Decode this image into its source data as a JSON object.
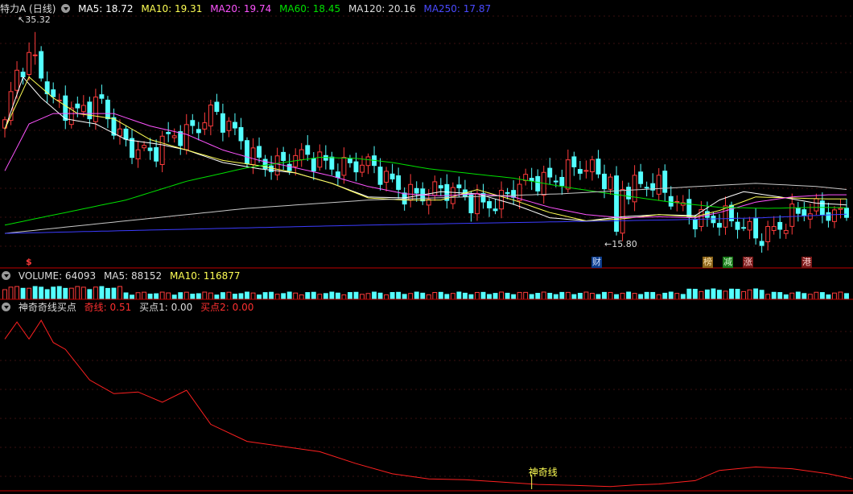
{
  "main_header": {
    "stock_name": "特力A",
    "period": "(日线)",
    "ma5": "MA5: 18.72",
    "ma10": "MA10: 19.31",
    "ma20": "MA20: 19.74",
    "ma60": "MA60: 18.45",
    "ma120": "MA120: 20.16",
    "ma250": "MA250: 17.87"
  },
  "high_label": "35.32",
  "low_label": "15.80",
  "events": [
    "$",
    "财",
    "榜",
    "减",
    "涨",
    "港"
  ],
  "volume_header": {
    "label": "VOLUME: 64093",
    "ma5": "MA5: 88152",
    "ma10": "MA10: 116877"
  },
  "indicator_header": {
    "name": "神奇奇线买点",
    "qixian": "奇线: 0.51",
    "buy1": "买点1: 0.00",
    "buy2": "买点2: 0.00"
  },
  "signal_label": "神奇线",
  "colors": {
    "up": "#ff3c3c",
    "down": "#54ffff",
    "ma5": "#ffffff",
    "ma10": "#ffff54",
    "ma20": "#ff54ff",
    "ma60": "#00e000",
    "ma120": "#c8c8c8",
    "ma250": "#3c3cff",
    "indicator": "#ff2020",
    "separator": "#c00000"
  },
  "chart_data": [
    {
      "type": "candlestick",
      "title": "特力A (日线)",
      "ylim": [
        14.0,
        37.0
      ],
      "grid": true,
      "x_count": 140,
      "ohlc_anchors": [
        [
          0,
          26.0
        ],
        [
          2,
          31.0
        ],
        [
          5,
          33.5
        ],
        [
          8,
          29.0
        ],
        [
          12,
          27.0
        ],
        [
          16,
          28.5
        ],
        [
          20,
          25.0
        ],
        [
          24,
          23.0
        ],
        [
          28,
          25.5
        ],
        [
          34,
          27.5
        ],
        [
          40,
          24.0
        ],
        [
          46,
          22.5
        ],
        [
          52,
          23.2
        ],
        [
          58,
          22.5
        ],
        [
          64,
          21.0
        ],
        [
          70,
          19.5
        ],
        [
          76,
          19.8
        ],
        [
          82,
          18.8
        ],
        [
          88,
          21.5
        ],
        [
          94,
          22.0
        ],
        [
          100,
          21.2
        ],
        [
          106,
          20.5
        ],
        [
          112,
          18.6
        ],
        [
          118,
          17.0
        ],
        [
          124,
          16.2
        ],
        [
          130,
          17.2
        ],
        [
          136,
          18.5
        ],
        [
          140,
          18.2
        ]
      ],
      "series": [
        {
          "name": "MA5",
          "values": [
            [
              0,
              26.0
            ],
            [
              3,
              31.0
            ],
            [
              6,
              29.0
            ],
            [
              10,
              27.0
            ],
            [
              15,
              26.5
            ],
            [
              20,
              25.0
            ],
            [
              26,
              24.5
            ],
            [
              30,
              24.0
            ],
            [
              36,
              22.8
            ],
            [
              42,
              22.2
            ],
            [
              48,
              21.8
            ],
            [
              54,
              20.8
            ],
            [
              60,
              19.5
            ],
            [
              66,
              19.4
            ],
            [
              72,
              20.0
            ],
            [
              78,
              19.8
            ],
            [
              84,
              18.8
            ],
            [
              90,
              17.5
            ],
            [
              96,
              17.2
            ],
            [
              102,
              17.6
            ],
            [
              108,
              17.8
            ],
            [
              114,
              17.7
            ],
            [
              118,
              19.2
            ],
            [
              122,
              20.0
            ],
            [
              128,
              19.5
            ],
            [
              134,
              18.9
            ],
            [
              140,
              18.7
            ]
          ]
        },
        {
          "name": "MA10",
          "values": [
            [
              0,
              26.0
            ],
            [
              4,
              31.0
            ],
            [
              8,
              29.0
            ],
            [
              12,
              27.5
            ],
            [
              18,
              27.0
            ],
            [
              24,
              25.0
            ],
            [
              30,
              24.0
            ],
            [
              36,
              23.0
            ],
            [
              42,
              22.5
            ],
            [
              48,
              21.8
            ],
            [
              54,
              20.8
            ],
            [
              60,
              19.4
            ],
            [
              66,
              19.2
            ],
            [
              72,
              19.2
            ],
            [
              78,
              20.2
            ],
            [
              84,
              19.2
            ],
            [
              90,
              18.0
            ],
            [
              96,
              17.2
            ],
            [
              102,
              17.4
            ],
            [
              108,
              17.8
            ],
            [
              114,
              17.6
            ],
            [
              118,
              18.2
            ],
            [
              124,
              19.5
            ],
            [
              130,
              19.4
            ],
            [
              136,
              19.3
            ],
            [
              140,
              19.3
            ]
          ]
        },
        {
          "name": "MA20",
          "values": [
            [
              0,
              22.0
            ],
            [
              4,
              26.5
            ],
            [
              8,
              27.5
            ],
            [
              12,
              27.5
            ],
            [
              18,
              27.5
            ],
            [
              24,
              26.3
            ],
            [
              30,
              25.5
            ],
            [
              36,
              24.0
            ],
            [
              42,
              23.0
            ],
            [
              48,
              22.3
            ],
            [
              54,
              21.5
            ],
            [
              60,
              20.5
            ],
            [
              66,
              19.8
            ],
            [
              72,
              19.6
            ],
            [
              78,
              19.8
            ],
            [
              84,
              19.5
            ],
            [
              90,
              18.5
            ],
            [
              96,
              17.8
            ],
            [
              102,
              17.5
            ],
            [
              108,
              17.6
            ],
            [
              114,
              17.5
            ],
            [
              118,
              18.0
            ],
            [
              124,
              19.0
            ],
            [
              130,
              19.5
            ],
            [
              136,
              19.7
            ],
            [
              140,
              19.7
            ]
          ]
        },
        {
          "name": "MA60",
          "values": [
            [
              0,
              16.8
            ],
            [
              10,
              18.0
            ],
            [
              20,
              19.2
            ],
            [
              30,
              21.0
            ],
            [
              40,
              22.3
            ],
            [
              46,
              22.8
            ],
            [
              52,
              23.3
            ],
            [
              58,
              23.2
            ],
            [
              64,
              22.8
            ],
            [
              70,
              22.2
            ],
            [
              76,
              21.8
            ],
            [
              84,
              21.3
            ],
            [
              92,
              20.5
            ],
            [
              100,
              19.8
            ],
            [
              110,
              19.0
            ],
            [
              118,
              18.5
            ],
            [
              126,
              18.4
            ],
            [
              134,
              18.5
            ],
            [
              140,
              18.45
            ]
          ]
        },
        {
          "name": "MA120",
          "values": [
            [
              0,
              16.0
            ],
            [
              20,
              17.2
            ],
            [
              40,
              18.4
            ],
            [
              60,
              19.2
            ],
            [
              76,
              19.5
            ],
            [
              92,
              19.8
            ],
            [
              108,
              20.3
            ],
            [
              124,
              20.8
            ],
            [
              134,
              20.5
            ],
            [
              140,
              20.16
            ]
          ]
        },
        {
          "name": "MA250",
          "values": [
            [
              0,
              16.0
            ],
            [
              30,
              16.4
            ],
            [
              60,
              16.8
            ],
            [
              90,
              17.1
            ],
            [
              110,
              17.3
            ],
            [
              125,
              17.5
            ],
            [
              140,
              17.87
            ]
          ]
        }
      ],
      "high": {
        "index": 5,
        "value": 35.32
      },
      "low": {
        "index": 101,
        "value": 15.8
      }
    },
    {
      "type": "bar",
      "title": "VOLUME",
      "current": 64093,
      "ma5": 88152,
      "ma10": 116877
    },
    {
      "type": "line",
      "title": "神奇奇线买点",
      "ylim": [
        0,
        1
      ],
      "series": [
        {
          "name": "奇线",
          "values": [
            [
              0,
              0.88
            ],
            [
              2,
              0.98
            ],
            [
              4,
              0.88
            ],
            [
              6,
              0.99
            ],
            [
              8,
              0.86
            ],
            [
              10,
              0.82
            ],
            [
              14,
              0.64
            ],
            [
              18,
              0.56
            ],
            [
              22,
              0.57
            ],
            [
              26,
              0.51
            ],
            [
              30,
              0.58
            ],
            [
              34,
              0.38
            ],
            [
              40,
              0.28
            ],
            [
              46,
              0.25
            ],
            [
              52,
              0.22
            ],
            [
              58,
              0.15
            ],
            [
              64,
              0.09
            ],
            [
              70,
              0.06
            ],
            [
              76,
              0.055
            ],
            [
              82,
              0.042
            ],
            [
              88,
              0.028
            ],
            [
              94,
              0.022
            ],
            [
              100,
              0.015
            ],
            [
              104,
              0.025
            ],
            [
              108,
              0.03
            ],
            [
              114,
              0.05
            ],
            [
              118,
              0.11
            ],
            [
              124,
              0.13
            ],
            [
              130,
              0.12
            ],
            [
              136,
              0.09
            ],
            [
              140,
              0.06
            ]
          ]
        }
      ],
      "signal": {
        "index": 87,
        "label": "神奇线"
      }
    }
  ]
}
